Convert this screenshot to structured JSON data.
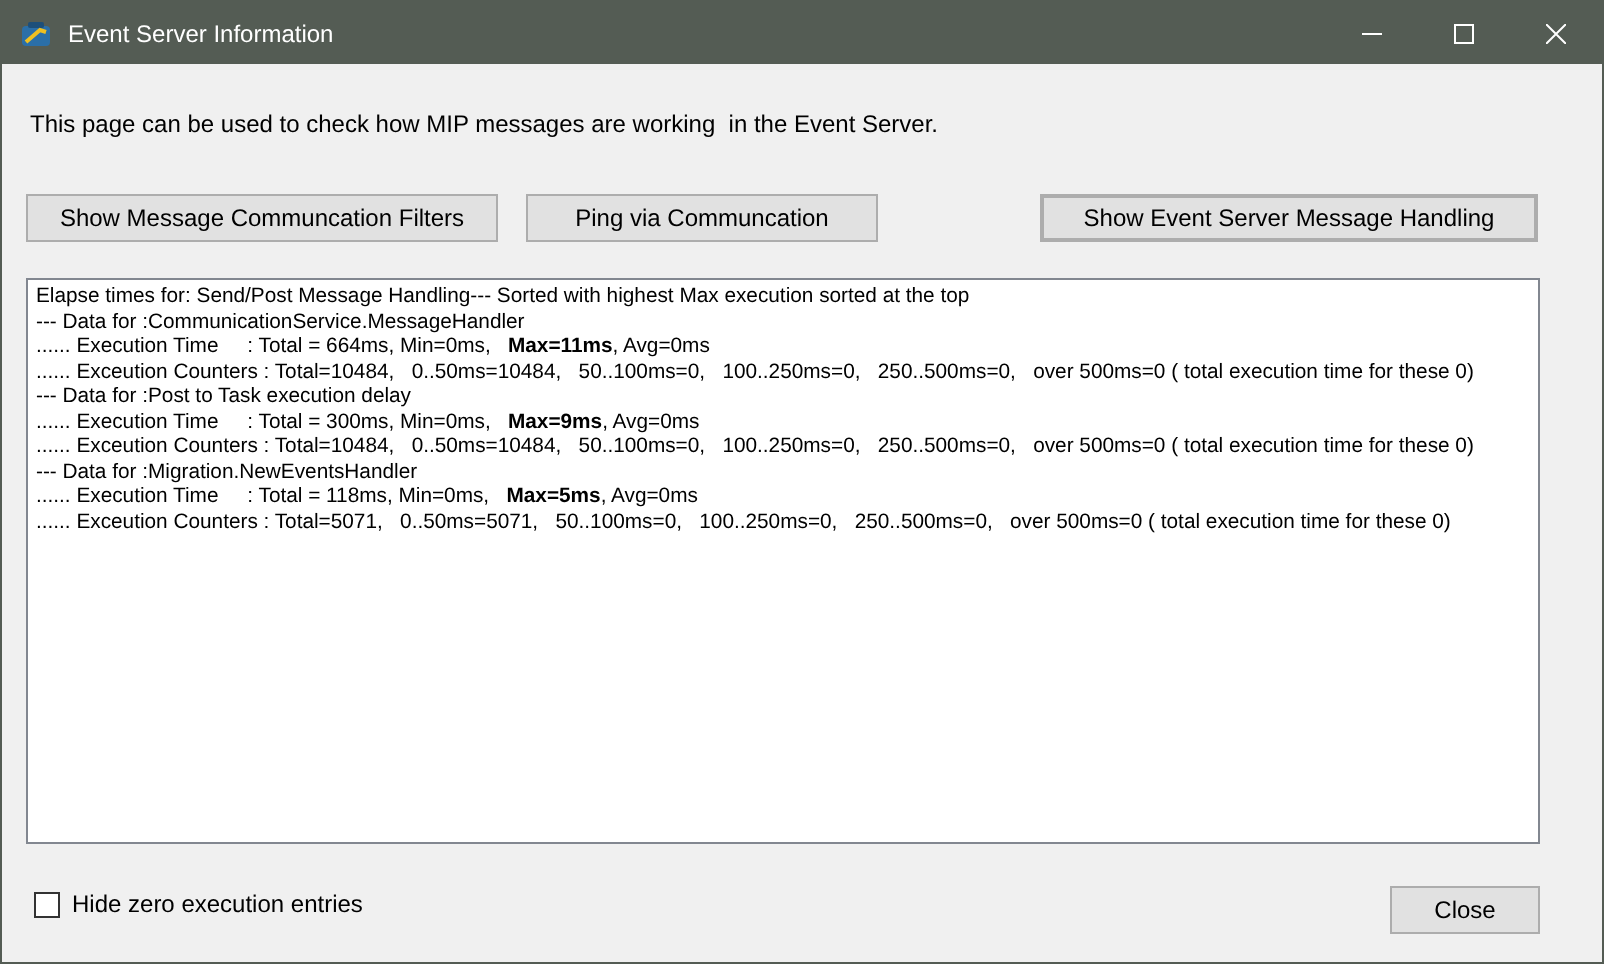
{
  "window": {
    "title": "Event Server Information"
  },
  "description": "This page can be used to check how MIP messages are working  in the Event Server.",
  "buttons": [
    {
      "label": "Show Message Communcation Filters"
    },
    {
      "label": "Ping via Communcation"
    },
    {
      "label": "Show Event Server Message Handling"
    }
  ],
  "log_lines": [
    "Elapse times for: Send/Post Message Handling--- Sorted with highest Max execution sorted at the top",
    "--- Data for :CommunicationService.MessageHandler",
    "...... Execution Time     : Total = 664ms, Min=0ms,   **Max=11ms**, Avg=0ms",
    "...... Exceution Counters : Total=10484,   0..50ms=10484,   50..100ms=0,   100..250ms=0,   250..500ms=0,   over 500ms=0 ( total execution time for these 0)",
    "--- Data for :Post to Task execution delay",
    "...... Execution Time     : Total = 300ms, Min=0ms,   **Max=9ms**, Avg=0ms",
    "...... Exceution Counters : Total=10484,   0..50ms=10484,   50..100ms=0,   100..250ms=0,   250..500ms=0,   over 500ms=0 ( total execution time for these 0)",
    "--- Data for :Migration.NewEventsHandler",
    "...... Execution Time     : Total = 118ms, Min=0ms,   **Max=5ms**, Avg=0ms",
    "...... Exceution Counters : Total=5071,   0..50ms=5071,   50..100ms=0,   100..250ms=0,   250..500ms=0,   over 500ms=0 ( total execution time for these 0)"
  ],
  "hide_zero": {
    "label": "Hide zero execution entries",
    "checked": false
  },
  "close_button": {
    "label": "Close"
  }
}
